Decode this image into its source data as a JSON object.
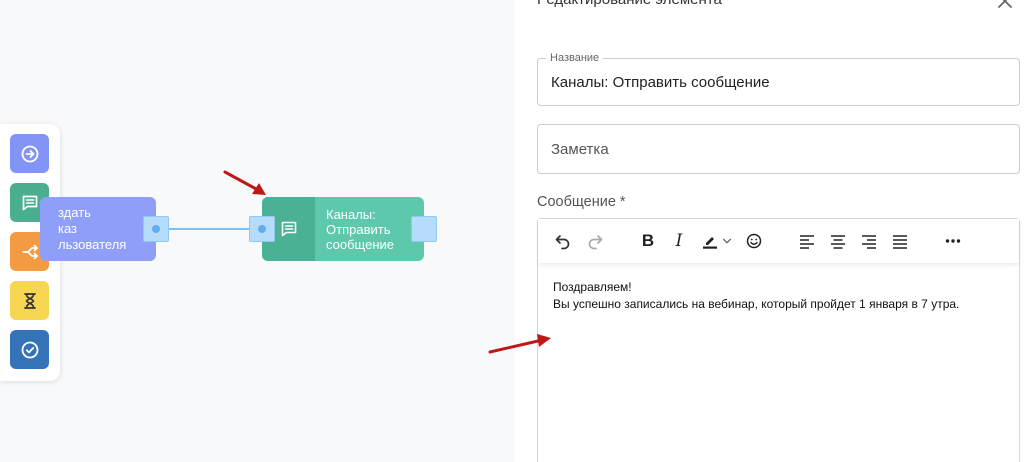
{
  "canvas": {
    "palette": [
      {
        "icon": "arrow-right-circle-icon",
        "color": "#8294f5"
      },
      {
        "icon": "chat-icon",
        "color": "#4bae8f"
      },
      {
        "icon": "split-arrows-icon",
        "color": "#f29b42"
      },
      {
        "icon": "hourglass-icon",
        "color": "#f7d653"
      },
      {
        "icon": "check-circle-icon",
        "color": "#3573b9"
      }
    ],
    "nodes": {
      "create_order": {
        "line1": "здать",
        "line2": "каз",
        "line3": "льзователя",
        "color": "#8e9ef9"
      },
      "channels": {
        "line1": "Каналы:",
        "line2": "Отправить",
        "line3": "сообщение",
        "color": "#5ec8ac",
        "icon": "chat-icon"
      }
    }
  },
  "panel": {
    "title": "Редактирование элемента",
    "name_field": {
      "label": "Название",
      "value": "Каналы: Отправить сообщение"
    },
    "note_field": {
      "placeholder": "Заметка"
    },
    "message": {
      "label": "Сообщение",
      "required_mark": "*",
      "toolbar": [
        "undo-icon",
        "redo-icon",
        "bold",
        "italic",
        "highlight-icon",
        "emoji-icon",
        "align-left-icon",
        "align-center-icon",
        "align-right-icon",
        "align-justify-icon",
        "more-icon"
      ],
      "toolbar_bold": "B",
      "toolbar_italic": "I",
      "body_line1": "Поздравляем!",
      "body_line2": "Вы успешно записались на вебинар, который пройдет 1 января в 7 утра."
    }
  },
  "colors": {
    "arrow": "#c01818",
    "port": "#b5dcfb",
    "connector": "#7cc0f4"
  }
}
